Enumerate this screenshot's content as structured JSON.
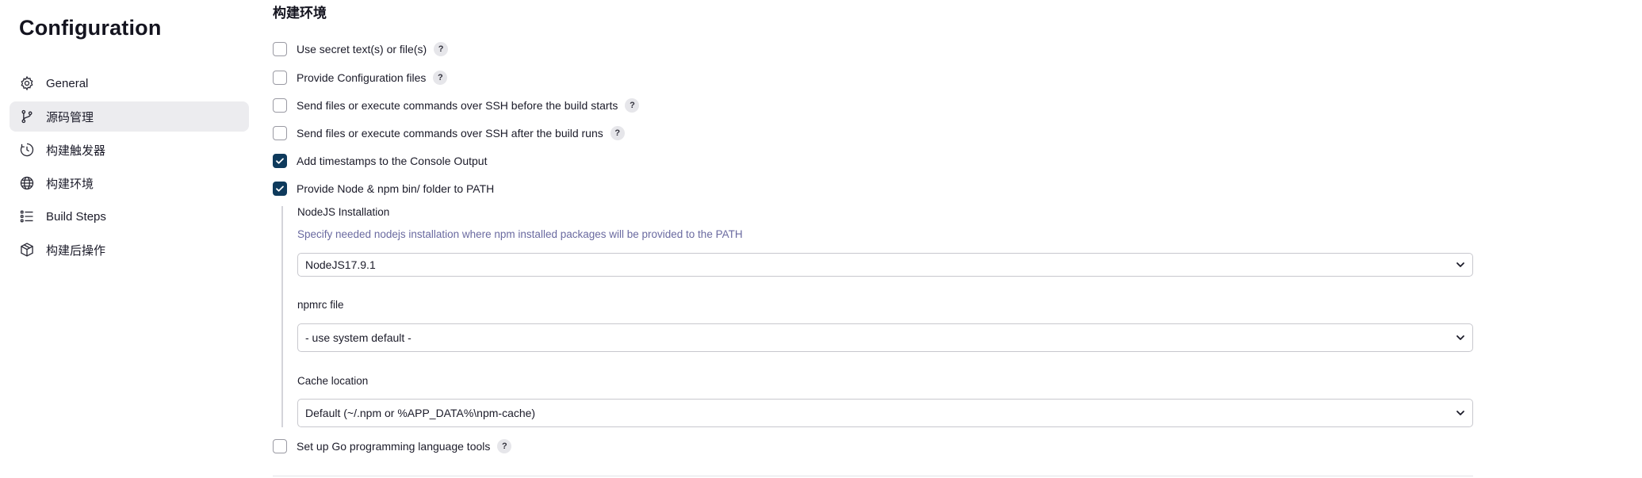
{
  "sidebar": {
    "title": "Configuration",
    "items": [
      {
        "label": "General",
        "icon": "gear-icon"
      },
      {
        "label": "源码管理",
        "icon": "branch-icon",
        "active": true
      },
      {
        "label": "构建触发器",
        "icon": "clock-icon"
      },
      {
        "label": "构建环境",
        "icon": "globe-icon"
      },
      {
        "label": "Build Steps",
        "icon": "list-icon"
      },
      {
        "label": "构建后操作",
        "icon": "package-icon"
      }
    ]
  },
  "main": {
    "section_title": "构建环境",
    "options": [
      {
        "label": "Use secret text(s) or file(s)",
        "checked": false,
        "help": "?"
      },
      {
        "label": "Provide Configuration files",
        "checked": false,
        "help": "?"
      },
      {
        "label": "Send files or execute commands over SSH before the build starts",
        "checked": false,
        "help": "?"
      },
      {
        "label": "Send files or execute commands over SSH after the build runs",
        "checked": false,
        "help": "?"
      },
      {
        "label": "Add timestamps to the Console Output",
        "checked": true
      },
      {
        "label": "Provide Node & npm bin/ folder to PATH",
        "checked": true
      },
      {
        "label": "Set up Go programming language tools",
        "checked": false,
        "help": "?"
      }
    ],
    "node": {
      "install_label": "NodeJS Installation",
      "install_desc": "Specify needed nodejs installation where npm installed packages will be provided to the PATH",
      "install_value": "NodeJS17.9.1",
      "npmrc_label": "npmrc file",
      "npmrc_value": "- use system default -",
      "cache_label": "Cache location",
      "cache_value": "Default (~/.npm or %APP_DATA%\\npm-cache)"
    }
  },
  "colors": {
    "checkbox_checked": "#0e3a5c",
    "nav_active_bg": "#ececef",
    "description_text": "#6a6aa0"
  }
}
